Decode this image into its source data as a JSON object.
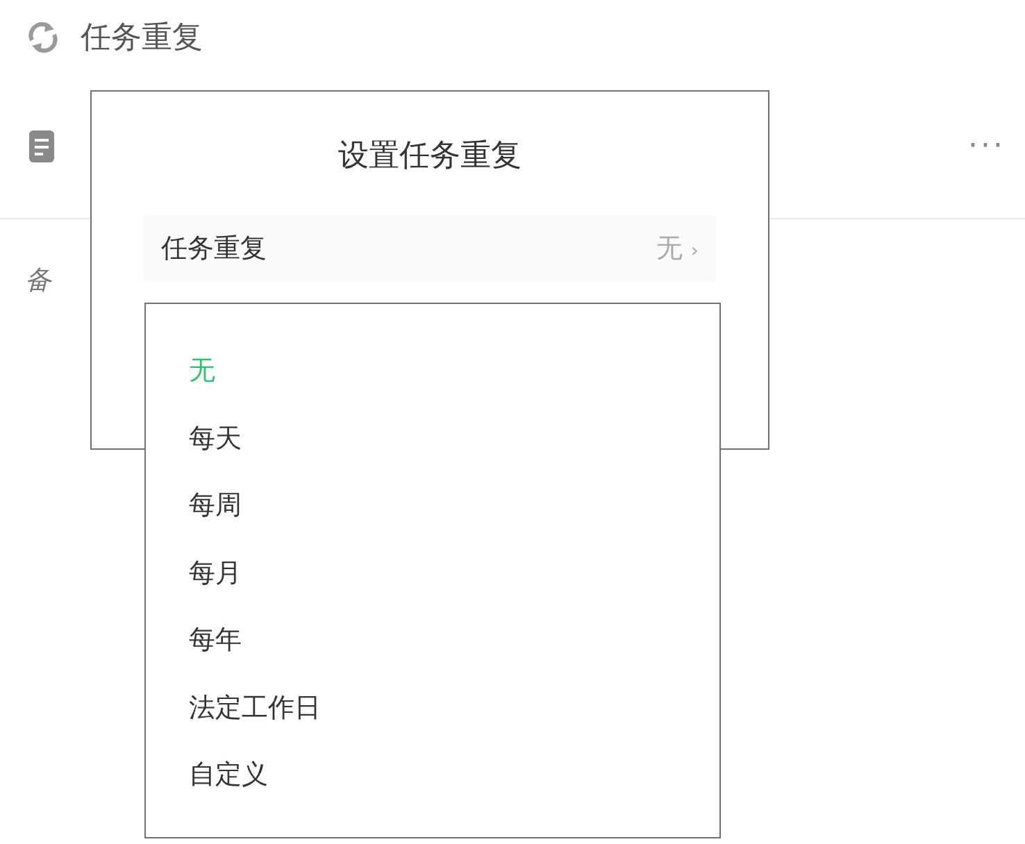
{
  "page": {
    "repeat_label": "任务重复",
    "more": "···",
    "note_label": "备"
  },
  "dialog": {
    "title": "设置任务重复",
    "field": {
      "label": "任务重复",
      "value": "无",
      "chevron": "›"
    }
  },
  "dropdown": {
    "options": [
      {
        "label": "无",
        "selected": true
      },
      {
        "label": "每天",
        "selected": false
      },
      {
        "label": "每周",
        "selected": false
      },
      {
        "label": "每月",
        "selected": false
      },
      {
        "label": "每年",
        "selected": false
      },
      {
        "label": "法定工作日",
        "selected": false
      },
      {
        "label": "自定义",
        "selected": false
      }
    ]
  }
}
